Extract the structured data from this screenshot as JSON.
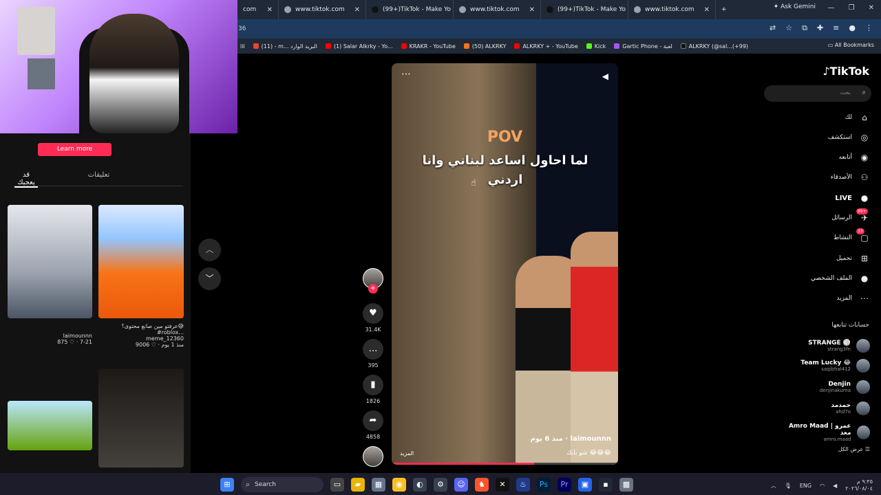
{
  "browser": {
    "tabs": [
      {
        "label": "com"
      },
      {
        "label": "www.tiktok.com"
      },
      {
        "label": "(99+)TikTok - Make Yo"
      },
      {
        "label": "www.tiktok.com"
      },
      {
        "label": "(99+)TikTok - Make Yo"
      },
      {
        "label": "www.tiktok.com"
      }
    ],
    "ask_gemini": "Ask Gemini",
    "address_fragment": "36",
    "bookmarks": [
      {
        "label": "lil"
      },
      {
        "label": "(11) - m... البريد الوارد"
      },
      {
        "label": "(1) Salar Alkrky - Yo..."
      },
      {
        "label": "KRAKR - YouTube"
      },
      {
        "label": "(50) ALKRKY"
      },
      {
        "label": "ALKRKY + - YouTube"
      },
      {
        "label": "Kick"
      },
      {
        "label": "Gartic Phone - لعبة"
      },
      {
        "label": "ALKRKY (@sal...(+99)"
      }
    ],
    "all_bookmarks": "All Bookmarks"
  },
  "left_panel": {
    "learn_more": "Learn more",
    "tab_comments": "تعليقات",
    "tab_you_may_like": "قد يعجبك",
    "items": [
      {
        "user": "laimounnn",
        "stats": "875 ♡ · 7-21"
      },
      {
        "caption": "عرفتو مين صانع محتوى؟😅 #roblox...",
        "user": "meme_12360",
        "stats": "9006 ♡ · منذ 1 يوم"
      }
    ]
  },
  "video": {
    "pov": "POV",
    "title": "لما احاول اساعد لبناني وانا اردني",
    "username": "laimounnn",
    "time": "منذ 6 يوم",
    "description": "شو بابك 😂😂😂",
    "more": "المزيد",
    "progress": 0.63
  },
  "actions": {
    "likes": "31.4K",
    "comments": "395",
    "saves": "1826",
    "shares": "4858"
  },
  "sidebar": {
    "logo": "TikTok",
    "search_placeholder": "بحث",
    "nav": [
      {
        "label": "لك"
      },
      {
        "label": "استكشف"
      },
      {
        "label": "أتابعه"
      },
      {
        "label": "الأصدقاء"
      },
      {
        "label": "LIVE"
      },
      {
        "label": "الرسائل",
        "badge": "99+"
      },
      {
        "label": "النشاط",
        "badge": "33"
      },
      {
        "label": "تحميل"
      },
      {
        "label": "الملف الشخصي"
      },
      {
        "label": "المزيد"
      }
    ],
    "following_header": "حسابات تتابعها",
    "following": [
      {
        "name": "STRANGE 🏐",
        "handle": "strang3fn"
      },
      {
        "name": "Team Lucky 😂",
        "handle": "saqibhal412"
      },
      {
        "name": "Denjin",
        "handle": "denjinakuma"
      },
      {
        "name": "حمدمد",
        "handle": "ahd7o"
      },
      {
        "name": "Amro Maad | عمرو معد",
        "handle": "amro.maad"
      }
    ],
    "see_all": "عرض الكل"
  },
  "taskbar": {
    "search": "Search",
    "lang": "ENG",
    "time": "٩:٣٥ م",
    "date": "٢٠٢٦/٠٨/٠٤"
  }
}
